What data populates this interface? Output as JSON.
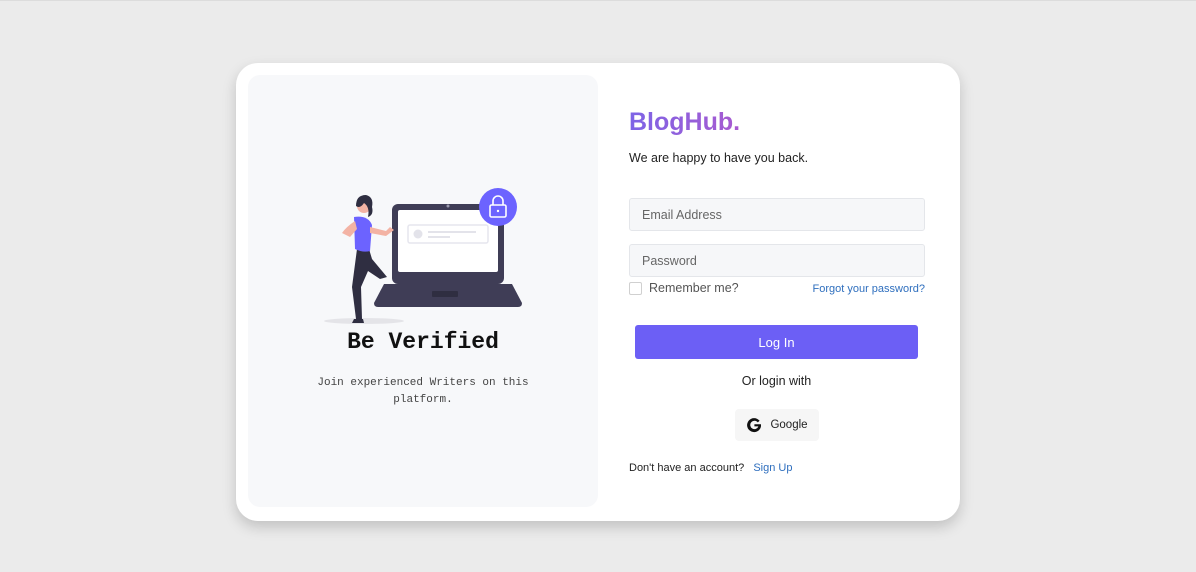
{
  "left_panel": {
    "title": "Be Verified",
    "subtitle": "Join experienced Writers on this platform."
  },
  "login": {
    "brand": "BlogHub.",
    "tagline": "We are happy to have you back.",
    "email_placeholder": "Email Address",
    "password_placeholder": "Password",
    "remember_label": "Remember me?",
    "forgot_label": "Forgot your password?",
    "login_label": "Log In",
    "or_label": "Or login with",
    "google_label": "Google",
    "no_account_label": "Don't have an account?",
    "signup_label": "Sign Up"
  },
  "colors": {
    "accent": "#6c5ff5",
    "link": "#2f6fbe",
    "brand_gradient_start": "#7d64e6",
    "brand_gradient_end": "#a85ad0"
  },
  "icons": {
    "illustration": "person-with-laptop-lock",
    "google": "google-g-icon"
  }
}
